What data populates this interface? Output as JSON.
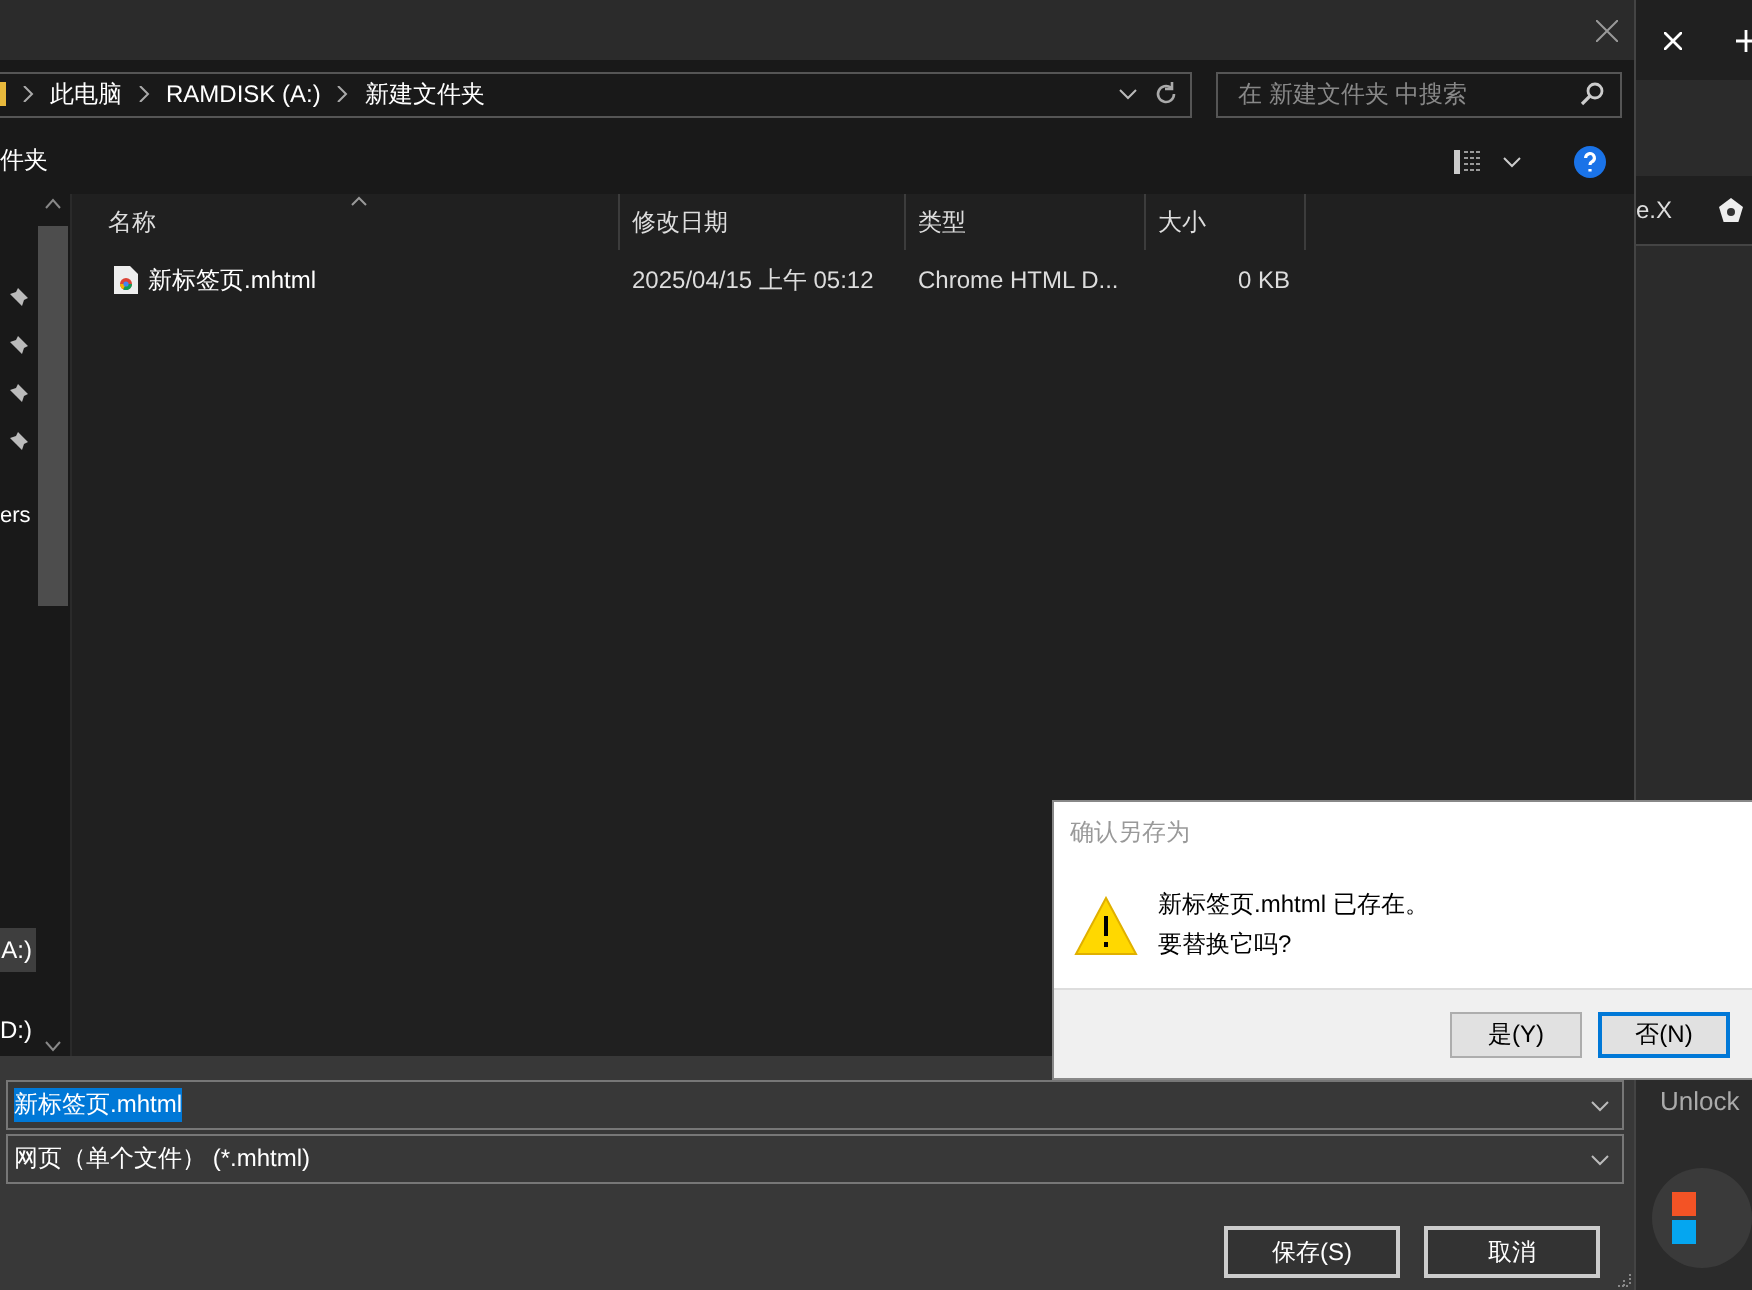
{
  "address_bar": {
    "breadcrumbs": [
      "此电脑",
      "RAMDISK (A:)",
      "新建文件夹"
    ]
  },
  "search": {
    "placeholder": "在 新建文件夹 中搜索"
  },
  "toolbar": {
    "new_folder_label": "件夹"
  },
  "nav_pane": {
    "top_items": [
      {
        "kind": "pin"
      },
      {
        "kind": "pin"
      },
      {
        "kind": "pin"
      },
      {
        "kind": "pin"
      },
      {
        "kind": "label",
        "label": "ers"
      }
    ],
    "bottom_items": [
      {
        "label": "A:)",
        "selected": true
      },
      {
        "label": "D:)",
        "selected": false
      }
    ]
  },
  "file_list": {
    "columns": [
      {
        "label": "名称",
        "sorted": true
      },
      {
        "label": "修改日期",
        "sorted": false
      },
      {
        "label": "类型",
        "sorted": false
      },
      {
        "label": "大小",
        "sorted": false
      }
    ],
    "rows": [
      {
        "name": "新标签页.mhtml",
        "modified": "2025/04/15 上午 05:12",
        "type": "Chrome HTML D...",
        "size": "0 KB"
      }
    ]
  },
  "filename": {
    "value": "新标签页.mhtml",
    "selected": true
  },
  "file_type": {
    "value": "网页（单个文件） (*.mhtml)"
  },
  "buttons": [
    "保存(S)",
    "取消"
  ],
  "browser": {
    "partial_text": "e.X",
    "partial_label": "Unlock"
  },
  "confirm": {
    "title": "确认另存为",
    "message": [
      "新标签页.mhtml 已存在。",
      "要替换它吗?"
    ],
    "buttons": [
      {
        "label": "是(Y)",
        "selected": false
      },
      {
        "label": "否(N)",
        "selected": true
      }
    ]
  }
}
